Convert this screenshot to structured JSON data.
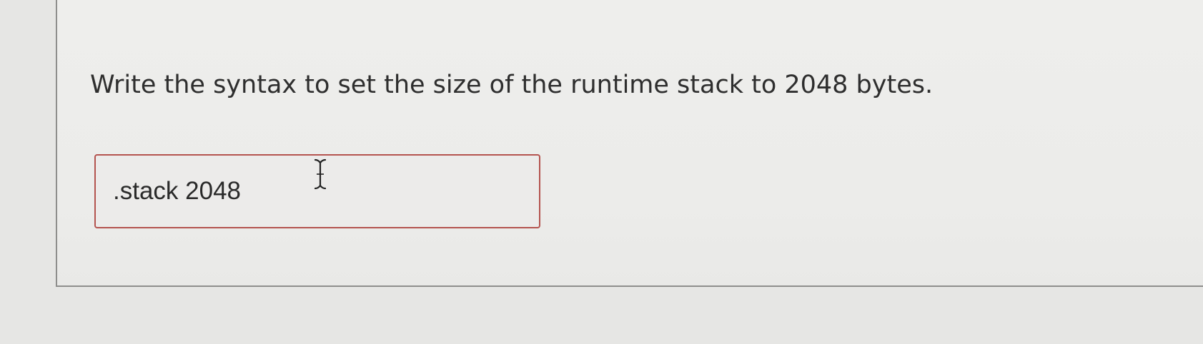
{
  "question": {
    "text": "Write the syntax to set the size of the runtime stack to 2048 bytes."
  },
  "answer": {
    "value": ".stack 2048"
  },
  "colors": {
    "page_background": "#e6e6e4",
    "panel_background": "#ececea",
    "panel_border": "#8e8e8c",
    "text": "#2e2e2e",
    "field_border_error": "#b4534f"
  },
  "icons": {
    "cursor": "text-cursor-icon"
  }
}
